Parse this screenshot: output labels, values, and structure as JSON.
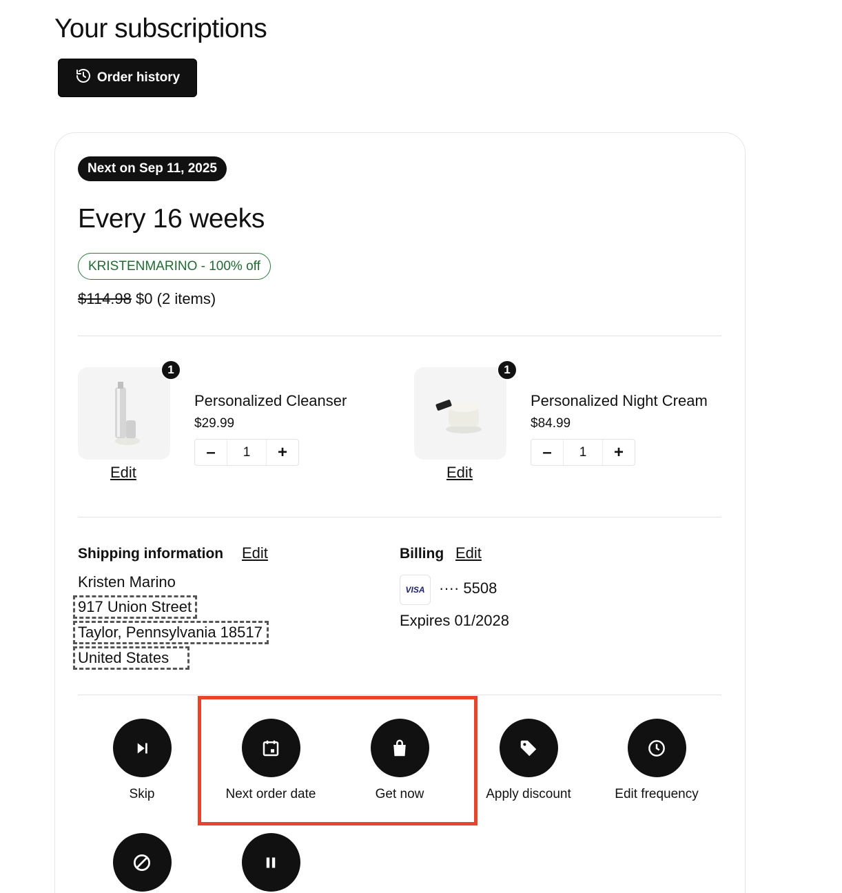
{
  "page_title": "Your subscriptions",
  "order_history_label": "Order history",
  "subscription": {
    "next_badge": "Next on Sep 11, 2025",
    "frequency": "Every 16 weeks",
    "discount": "KRISTENMARINO - 100% off",
    "original_price": "$114.98",
    "current_price": "$0",
    "item_count": "(2 items)",
    "items": [
      {
        "name": "Personalized Cleanser",
        "price": "$29.99",
        "quantity": "1",
        "badge": "1",
        "edit_label": "Edit"
      },
      {
        "name": "Personalized Night Cream",
        "price": "$84.99",
        "quantity": "1",
        "badge": "1",
        "edit_label": "Edit"
      }
    ],
    "shipping": {
      "heading": "Shipping information",
      "edit_label": "Edit",
      "name": "Kristen Marino",
      "street": "917 Union Street",
      "city_line": "Taylor, Pennsylvania 18517",
      "country": "United States"
    },
    "billing": {
      "heading": "Billing",
      "edit_label": "Edit",
      "card_brand": "VISA",
      "card_masked": "···· 5508",
      "expiry": "Expires 01/2028"
    },
    "actions": [
      {
        "label": "Skip",
        "icon": "skip-next-icon"
      },
      {
        "label": "Next order date",
        "icon": "calendar-icon"
      },
      {
        "label": "Get now",
        "icon": "shopping-bag-icon"
      },
      {
        "label": "Apply discount",
        "icon": "tag-icon"
      },
      {
        "label": "Edit frequency",
        "icon": "clock-icon"
      },
      {
        "label": "",
        "icon": "cancel-icon"
      },
      {
        "label": "",
        "icon": "pause-icon"
      }
    ]
  },
  "colors": {
    "primary": "#111111",
    "discount_green": "#1f6b30",
    "highlight": "#e8432b"
  }
}
